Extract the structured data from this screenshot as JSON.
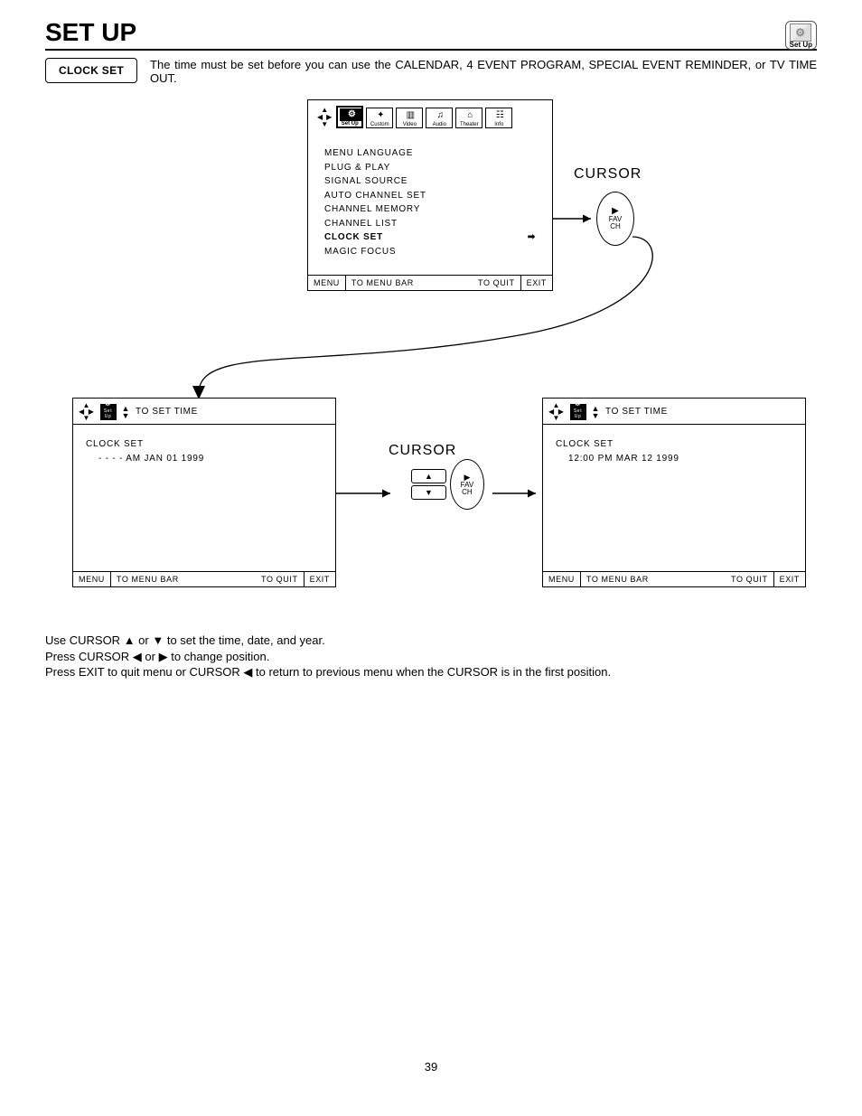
{
  "page": {
    "title": "SET UP",
    "corner_icon_label": "Set Up",
    "number": "39"
  },
  "header": {
    "box_label": "CLOCK SET",
    "intro": "The time must be set before you can use the CALENDAR, 4 EVENT PROGRAM, SPECIAL EVENT REMINDER, or TV TIME OUT."
  },
  "tabs": [
    "Set Up",
    "Custom",
    "Video",
    "Audio",
    "Theater",
    "Info"
  ],
  "menu1": {
    "items": [
      "MENU LANGUAGE",
      "PLUG & PLAY",
      "SIGNAL SOURCE",
      "AUTO CHANNEL SET",
      "CHANNEL MEMORY",
      "CHANNEL LIST",
      "CLOCK SET",
      "MAGIC FOCUS"
    ],
    "selected_index": 6
  },
  "footer": {
    "menu": "MENU",
    "to_menu_bar": "TO MENU BAR",
    "to_quit": "TO QUIT",
    "exit": "EXIT"
  },
  "cursor_label": "CURSOR",
  "fav_ch": "FAV\nCH",
  "set_time_bar": {
    "label": "TO SET TIME",
    "mini_icon": "Set Up"
  },
  "clock2": {
    "heading": "CLOCK SET",
    "value": "- -  - - AM JAN 01 1999"
  },
  "clock3": {
    "heading": "CLOCK SET",
    "value": "12:00 PM MAR 12 1999"
  },
  "instructions": {
    "l1_a": "Use CURSOR ",
    "l1_b": " or ",
    "l1_c": " to set the time, date, and year.",
    "l2_a": "Press CURSOR ",
    "l2_b": " or ",
    "l2_c": " to change position.",
    "l3_a": "Press EXIT to quit menu or CURSOR ",
    "l3_b": " to return to previous menu when the CURSOR is in the first position."
  },
  "glyphs": {
    "up": "▲",
    "down": "▼",
    "left": "◀",
    "right": "▶",
    "arrow_right_small": "➡"
  }
}
